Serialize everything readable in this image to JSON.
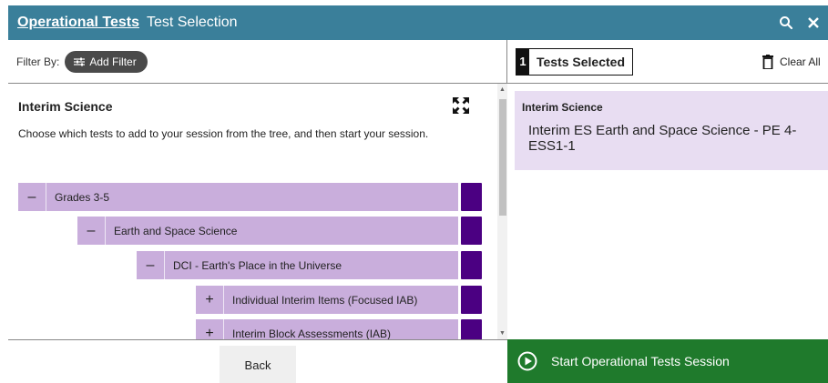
{
  "header": {
    "breadcrumb": "Operational Tests",
    "title": "Test Selection",
    "search_icon": "search-icon",
    "close_icon": "close-icon"
  },
  "filter": {
    "label": "Filter By:",
    "add_filter_label": "Add Filter"
  },
  "tree": {
    "heading": "Interim Science",
    "description": "Choose which tests to add to your session from the tree, and then start your session.",
    "rows": [
      {
        "toggle": "–",
        "label": "Grades 3-5"
      },
      {
        "toggle": "–",
        "label": "Earth and Space Science"
      },
      {
        "toggle": "–",
        "label": "DCI - Earth's Place in the Universe"
      },
      {
        "toggle": "+",
        "label": "Individual Interim Items (Focused IAB)"
      },
      {
        "toggle": "+",
        "label": "Interim Block Assessments (IAB)"
      }
    ]
  },
  "footer": {
    "back_label": "Back",
    "start_label": "Start Operational Tests Session"
  },
  "selected": {
    "count": "1",
    "title": "Tests Selected",
    "clear_label": "Clear All",
    "items": [
      {
        "category": "Interim Science",
        "name": "Interim ES Earth and Space Science - PE 4-ESS1-1"
      }
    ]
  },
  "colors": {
    "header": "#3a7f9a",
    "tree_row": "#c9aedc",
    "tree_handle": "#4b0082",
    "selected_card": "#e8ddf2",
    "start_button": "#1f7a2c"
  }
}
